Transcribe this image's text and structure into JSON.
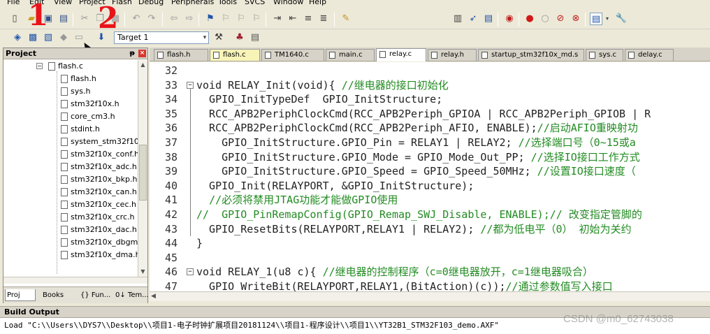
{
  "menu": {
    "items": [
      "File",
      "Edit",
      "View",
      "Project",
      "Flash",
      "Debug",
      "Peripherals",
      "Tools",
      "SVCS",
      "Window",
      "Help"
    ]
  },
  "toolbar2": {
    "target": "Target 1"
  },
  "annotations": {
    "one": "1",
    "two": "2"
  },
  "project_panel": {
    "title": "Project",
    "pin": "ᵽ",
    "close": "×",
    "expanded_file": "flash.c",
    "files": [
      "flash.h",
      "sys.h",
      "stm32f10x.h",
      "core_cm3.h",
      "stdint.h",
      "system_stm32f10:",
      "stm32f10x_conf.h",
      "stm32f10x_adc.h",
      "stm32f10x_bkp.h",
      "stm32f10x_can.h",
      "stm32f10x_cec.h",
      "stm32f10x_crc.h",
      "stm32f10x_dac.h",
      "stm32f10x_dbgm",
      "stm32f10x_dma.h"
    ],
    "tabs": [
      "Proj",
      "Books",
      "{} Fun...",
      "0↓ Tem..."
    ]
  },
  "editor": {
    "tabs": [
      "flash.h",
      "flash.c",
      "TM1640.c",
      "main.c",
      "relay.c",
      "relay.h",
      "startup_stm32f10x_md.s",
      "sys.c",
      "delay.c"
    ],
    "active_tab": "relay.c",
    "lines": [
      {
        "n": "32",
        "code": "",
        "comment": ""
      },
      {
        "n": "33",
        "code": "void RELAY_Init(void){ ",
        "comment": "//继电器的接口初始化"
      },
      {
        "n": "34",
        "code": "  GPIO_InitTypeDef  GPIO_InitStructure;",
        "comment": ""
      },
      {
        "n": "35",
        "code": "  RCC_APB2PeriphClockCmd(RCC_APB2Periph_GPIOA | RCC_APB2Periph_GPIOB | R",
        "comment": ""
      },
      {
        "n": "36",
        "code": "  RCC_APB2PeriphClockCmd(RCC_APB2Periph_AFIO, ENABLE);",
        "comment": "//启动AFIO重映射功"
      },
      {
        "n": "37",
        "code": "    GPIO_InitStructure.GPIO_Pin = RELAY1 | RELAY2; ",
        "comment": "//选择端口号（0~15或a"
      },
      {
        "n": "38",
        "code": "    GPIO_InitStructure.GPIO_Mode = GPIO_Mode_Out_PP; ",
        "comment": "//选择IO接口工作方式"
      },
      {
        "n": "39",
        "code": "    GPIO_InitStructure.GPIO_Speed = GPIO_Speed_50MHz; ",
        "comment": "//设置IO接口速度（"
      },
      {
        "n": "40",
        "code": "  GPIO_Init(RELAYPORT, &GPIO_InitStructure);",
        "comment": ""
      },
      {
        "n": "41",
        "code": "  ",
        "comment": "//必须将禁用JTAG功能才能做GPIO使用"
      },
      {
        "n": "42",
        "code": "",
        "comment": "//  GPIO_PinRemapConfig(GPIO_Remap_SWJ_Disable, ENABLE);// 改变指定管脚的"
      },
      {
        "n": "43",
        "code": "  GPIO_ResetBits(RELAYPORT,RELAY1 | RELAY2); ",
        "comment": "//都为低电平（0） 初始为关约"
      },
      {
        "n": "44",
        "code": "}",
        "comment": ""
      },
      {
        "n": "45",
        "code": "",
        "comment": ""
      },
      {
        "n": "46",
        "code": "void RELAY_1(u8 c){ ",
        "comment": "//继电器的控制程序（c=0继电器放开，c=1继电器吸合）"
      },
      {
        "n": "47",
        "code": "  GPIO_WriteBit(RELAYPORT,RELAY1,(BitAction)(c));",
        "comment": "//通过参数值写入接口"
      }
    ]
  },
  "build": {
    "title": "Build Output",
    "line": "Load \"C:\\\\Users\\\\DYS7\\\\Desktop\\\\项目1-电子时钟扩展项目20181124\\\\项目1-程序设计\\\\项目1\\\\YT32B1_STM32F103_demo.AXF\"",
    "watermark": "CSDN @m0_62743038"
  },
  "colors": {
    "comment": "#228B22",
    "annotation": "#E8141A",
    "panel_bg": "#ECE9D8"
  }
}
